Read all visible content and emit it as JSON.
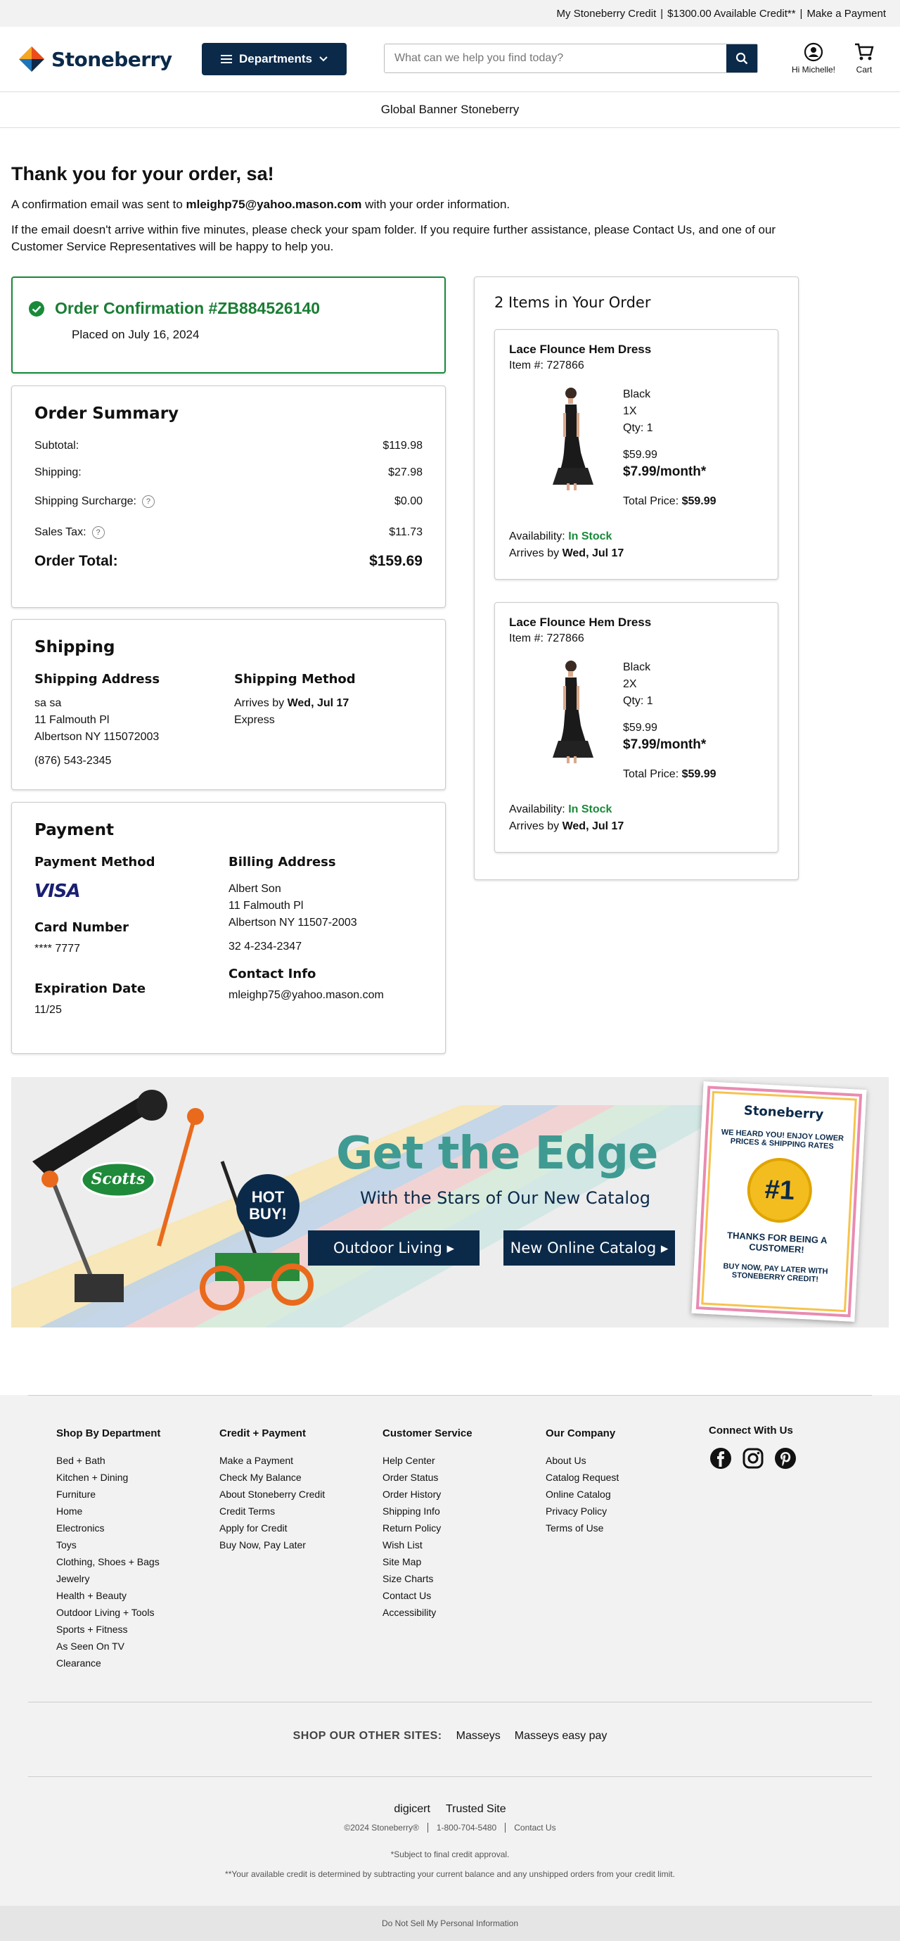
{
  "topbar": {
    "credit_link": "My Stoneberry Credit",
    "available": "$1300.00 Available Credit**",
    "payment_link": "Make a Payment"
  },
  "header": {
    "logo": "Stoneberry",
    "departments": "Departments",
    "search_placeholder": "What can we help you find today?",
    "account_label": "Hi Michelle!",
    "cart_label": "Cart"
  },
  "global_banner": "Global Banner Stoneberry",
  "thanks": {
    "title": "Thank you for your order, sa!",
    "confirm_prefix": "A confirmation email was sent to ",
    "email": "mleighp75@yahoo.mason.com",
    "confirm_suffix": " with your order information.",
    "help_prefix": "If the email doesn't arrive within five minutes, please check your spam folder. If you require further assistance, please ",
    "contact_link": "Contact Us",
    "help_suffix": ", and one of our Customer Service Representatives will be happy to help you."
  },
  "confirmation": {
    "title": "Order Confirmation #ZB884526140",
    "placed": "Placed on July 16, 2024"
  },
  "summary": {
    "title": "Order Summary",
    "rows": [
      {
        "label": "Subtotal:",
        "value": "$119.98"
      },
      {
        "label": "Shipping:",
        "value": "$27.98"
      },
      {
        "label": "Shipping Surcharge:",
        "value": "$0.00"
      },
      {
        "label": "Sales Tax:",
        "value": "$11.73"
      }
    ],
    "total_label": "Order Total:",
    "total_value": "$159.69"
  },
  "shipping": {
    "title": "Shipping",
    "address_heading": "Shipping Address",
    "address_lines": [
      "sa sa",
      "11 Falmouth Pl",
      "Albertson NY 115072003"
    ],
    "phone": "(876) 543-2345",
    "method_heading": "Shipping Method",
    "arrives_prefix": "Arrives by ",
    "arrives_date": "Wed, Jul 17",
    "method": "Express"
  },
  "payment": {
    "title": "Payment",
    "method_heading": "Payment Method",
    "card_brand": "VISA",
    "card_number_heading": "Card Number",
    "card_number": "**** 7777",
    "exp_heading": "Expiration Date",
    "exp": "11/25",
    "billing_heading": "Billing Address",
    "billing_lines": [
      "Albert Son",
      "11 Falmouth Pl",
      "Albertson NY 11507-2003"
    ],
    "billing_phone": "32 4-234-2347",
    "contact_heading": "Contact Info",
    "contact_email": "mleighp75@yahoo.mason.com"
  },
  "items": {
    "heading": "2 Items in Your Order",
    "list": [
      {
        "name": "Lace Flounce Hem Dress",
        "item_no": "Item #: 727866",
        "color": "Black",
        "size": "1X",
        "qty": "Qty: 1",
        "price": "$59.99",
        "monthly": "$7.99/month*",
        "total_label": "Total Price: ",
        "total": "$59.99",
        "avail_label": "Availability: ",
        "avail": "In Stock",
        "arrives_label": "Arrives by ",
        "arrives": "Wed, Jul 17"
      },
      {
        "name": "Lace Flounce Hem Dress",
        "item_no": "Item #: 727866",
        "color": "Black",
        "size": "2X",
        "qty": "Qty: 1",
        "price": "$59.99",
        "monthly": "$7.99/month*",
        "total_label": "Total Price: ",
        "total": "$59.99",
        "avail_label": "Availability: ",
        "avail": "In Stock",
        "arrives_label": "Arrives by ",
        "arrives": "Wed, Jul 17"
      }
    ]
  },
  "promo": {
    "heading": "Get the Edge",
    "subheading": "With the Stars of Our New Catalog",
    "btn_outdoor": "Outdoor Living ▸",
    "btn_catalog": "New Online Catalog ▸",
    "brand": "Scotts",
    "badge": "HOT BUY!",
    "catalog_logo": "Stoneberry",
    "catalog_text1": "WE HEARD YOU! ENJOY LOWER PRICES & SHIPPING RATES",
    "catalog_medal": "#1",
    "catalog_text2": "THANKS FOR BEING A CUSTOMER!",
    "catalog_text3": "BUY NOW, PAY LATER WITH STONEBERRY CREDIT!"
  },
  "footer": {
    "cols": [
      {
        "title": "Shop By Department",
        "links": [
          "Bed + Bath",
          "Kitchen + Dining",
          "Furniture",
          "Home",
          "Electronics",
          "Toys",
          "Clothing, Shoes + Bags",
          "Jewelry",
          "Health + Beauty",
          "Outdoor Living + Tools",
          "Sports + Fitness",
          "As Seen On TV",
          "Clearance"
        ]
      },
      {
        "title": "Credit + Payment",
        "links": [
          "Make a Payment",
          "Check My Balance",
          "About Stoneberry Credit",
          "Credit Terms",
          "Apply for Credit",
          "Buy Now, Pay Later"
        ]
      },
      {
        "title": "Customer Service",
        "links": [
          "Help Center",
          "Order Status",
          "Order History",
          "Shipping Info",
          "Return Policy",
          "Wish List",
          "Site Map",
          "Size Charts",
          "Contact Us",
          "Accessibility"
        ]
      },
      {
        "title": "Our Company",
        "links": [
          "About Us",
          "Catalog Request",
          "Online Catalog",
          "Privacy Policy",
          "Terms of Use"
        ]
      }
    ],
    "connect": "Connect With Us",
    "other_sites_label": "SHOP OUR OTHER SITES:",
    "other_sites": [
      "Masseys",
      "Masseys easy pay"
    ],
    "badges": [
      "digicert",
      "Trusted Site"
    ],
    "copyright": "©2024 Stoneberry®",
    "phone": "1-800-704-5480",
    "contact": "Contact Us",
    "note1": "*Subject to final credit approval.",
    "note2": "**Your available credit is determined by subtracting your current balance and any unshipped orders from your credit limit.",
    "dns": "Do Not Sell My Personal Information"
  }
}
